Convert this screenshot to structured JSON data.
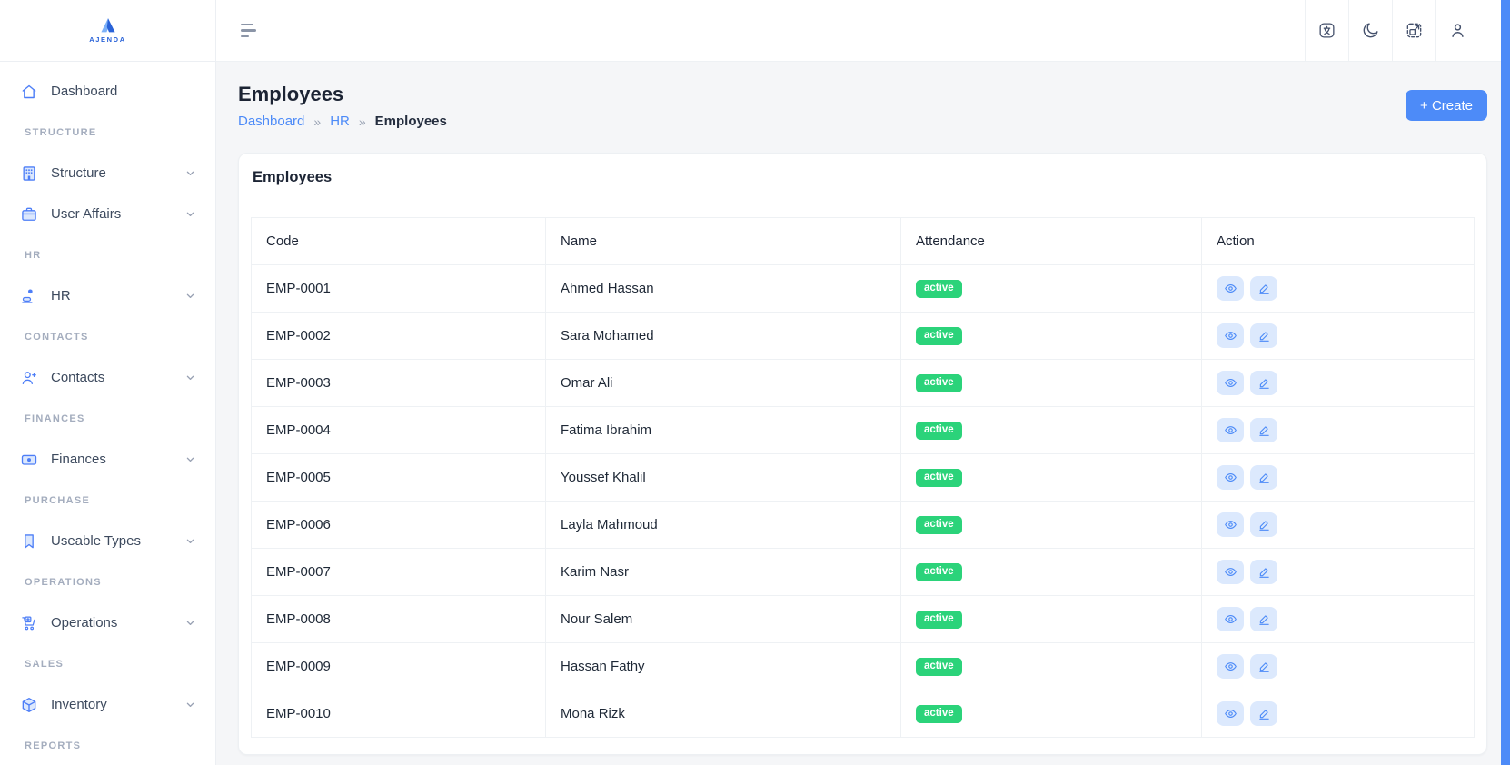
{
  "brand": {
    "name": "AJENDA",
    "logo_icon": "brand-triangle-icon"
  },
  "colors": {
    "primary": "#4d8bf8",
    "success": "#2bd37a",
    "sidebar_icon_blue": "#4d7ef7",
    "action_button_bg": "#dce9fd"
  },
  "sidebar": {
    "entries": [
      {
        "type": "item",
        "icon": "home-icon",
        "label": "Dashboard",
        "chevron": false
      },
      {
        "type": "section",
        "label": "STRUCTURE"
      },
      {
        "type": "item",
        "icon": "building-icon",
        "label": "Structure",
        "chevron": true
      },
      {
        "type": "item",
        "icon": "briefcase-icon",
        "label": "User Affairs",
        "chevron": true
      },
      {
        "type": "section",
        "label": "HR"
      },
      {
        "type": "item",
        "icon": "person-desk-icon",
        "label": "HR",
        "chevron": true
      },
      {
        "type": "section",
        "label": "CONTACTS"
      },
      {
        "type": "item",
        "icon": "person-plus-icon",
        "label": "Contacts",
        "chevron": true
      },
      {
        "type": "section",
        "label": "FINANCES"
      },
      {
        "type": "item",
        "icon": "banknote-icon",
        "label": "Finances",
        "chevron": true
      },
      {
        "type": "section",
        "label": "PURCHASE"
      },
      {
        "type": "item",
        "icon": "bookmark-icon",
        "label": "Useable Types",
        "chevron": true
      },
      {
        "type": "section",
        "label": "OPERATIONS"
      },
      {
        "type": "item",
        "icon": "cart-plus-icon",
        "label": "Operations",
        "chevron": true
      },
      {
        "type": "section",
        "label": "SALES"
      },
      {
        "type": "item",
        "icon": "box-icon",
        "label": "Inventory",
        "chevron": true
      },
      {
        "type": "section",
        "label": "REPORTS"
      }
    ]
  },
  "topbar": {
    "menu_toggle_icon": "hamburger-icon",
    "icons": [
      "translate-icon",
      "moon-icon",
      "expand-icon",
      "user-icon"
    ]
  },
  "page": {
    "title": "Employees",
    "breadcrumb": [
      {
        "label": "Dashboard",
        "link": true
      },
      {
        "label": "HR",
        "link": true
      },
      {
        "label": "Employees",
        "link": false
      }
    ],
    "breadcrumb_separator": "»",
    "create_button": "+ Create"
  },
  "card": {
    "title": "Employees",
    "table": {
      "columns": [
        "Code",
        "Name",
        "Attendance",
        "Action"
      ],
      "actions": [
        {
          "name": "view",
          "icon": "eye-icon"
        },
        {
          "name": "edit",
          "icon": "pencil-icon"
        }
      ],
      "rows": [
        {
          "code": "EMP-0001",
          "name": "Ahmed Hassan",
          "attendance": "active"
        },
        {
          "code": "EMP-0002",
          "name": "Sara Mohamed",
          "attendance": "active"
        },
        {
          "code": "EMP-0003",
          "name": "Omar Ali",
          "attendance": "active"
        },
        {
          "code": "EMP-0004",
          "name": "Fatima Ibrahim",
          "attendance": "active"
        },
        {
          "code": "EMP-0005",
          "name": "Youssef Khalil",
          "attendance": "active"
        },
        {
          "code": "EMP-0006",
          "name": "Layla Mahmoud",
          "attendance": "active"
        },
        {
          "code": "EMP-0007",
          "name": "Karim Nasr",
          "attendance": "active"
        },
        {
          "code": "EMP-0008",
          "name": "Nour Salem",
          "attendance": "active"
        },
        {
          "code": "EMP-0009",
          "name": "Hassan Fathy",
          "attendance": "active"
        },
        {
          "code": "EMP-0010",
          "name": "Mona Rizk",
          "attendance": "active"
        }
      ]
    }
  }
}
